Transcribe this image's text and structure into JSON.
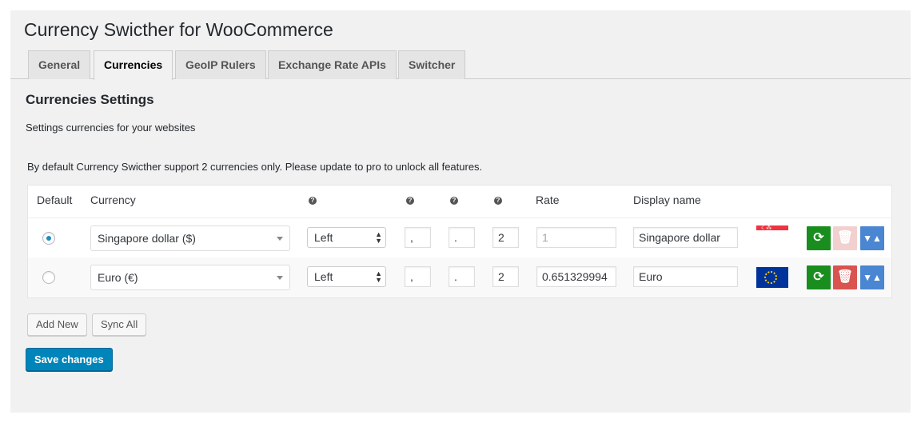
{
  "page": {
    "title": "Currency Swicther for WooCommerce"
  },
  "tabs": [
    {
      "label": "General",
      "active": false
    },
    {
      "label": "Currencies",
      "active": true
    },
    {
      "label": "GeoIP Rulers",
      "active": false
    },
    {
      "label": "Exchange Rate APIs",
      "active": false
    },
    {
      "label": "Switcher",
      "active": false
    }
  ],
  "section": {
    "title": "Currencies Settings",
    "description": "Settings currencies for your websites",
    "notice": "By default Currency Swicther support 2 currencies only. Please update to pro to unlock all features."
  },
  "table": {
    "headers": {
      "default": "Default",
      "currency": "Currency",
      "rate": "Rate",
      "display_name": "Display name"
    },
    "help_icon_glyph": "?",
    "rows": [
      {
        "default": true,
        "currency": "Singapore dollar ($)",
        "position": "Left",
        "thousand_sep": ",",
        "decimal_sep": ".",
        "decimals": "2",
        "rate": "1",
        "rate_disabled": true,
        "display_name": "Singapore dollar",
        "flag": "singapore-flag",
        "delete_disabled": true
      },
      {
        "default": false,
        "currency": "Euro (€)",
        "position": "Left",
        "thousand_sep": ",",
        "decimal_sep": ".",
        "decimals": "2",
        "rate": "0.651329994",
        "rate_disabled": false,
        "display_name": "Euro",
        "flag": "eu-flag",
        "delete_disabled": false
      }
    ]
  },
  "buttons": {
    "add_new": "Add New",
    "sync_all": "Sync All",
    "save": "Save changes"
  },
  "colors": {
    "primary": "#0085ba",
    "sync": "#198d1e",
    "delete": "#d9534f",
    "move": "#4a86d1"
  }
}
